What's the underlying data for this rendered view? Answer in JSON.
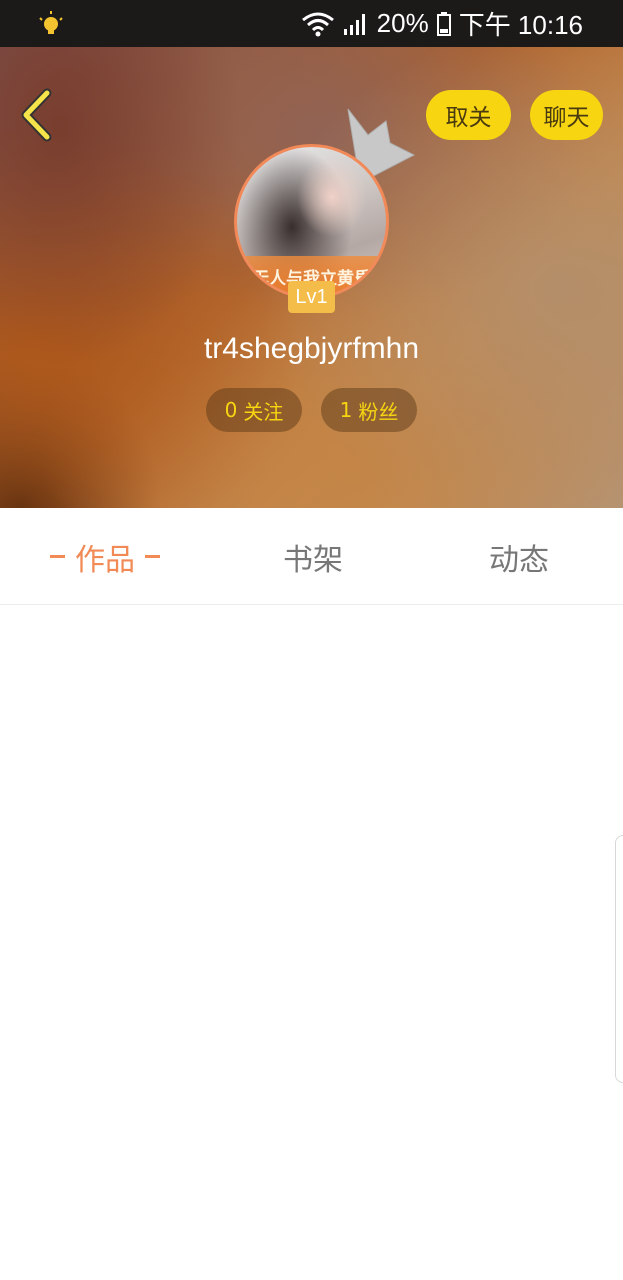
{
  "status_bar": {
    "battery_percent": "20%",
    "time": "下午 10:16",
    "icons": [
      "notification-bulb-icon",
      "wifi-icon",
      "signal-icon",
      "battery-icon"
    ]
  },
  "header": {
    "back_icon": "chevron-left-icon",
    "unfollow_label": "取关",
    "chat_label": "聊天",
    "avatar_caption": "无人与我立黄昏",
    "level": "Lv1",
    "username": "tr4shegbjyrfmhn",
    "following_count": "0",
    "following_label": "关注",
    "fans_count": "1",
    "fans_label": "粉丝"
  },
  "tabs": [
    {
      "label": "作品",
      "active": true
    },
    {
      "label": "书架",
      "active": false
    },
    {
      "label": "动态",
      "active": false
    }
  ],
  "colors": {
    "accent_orange": "#f18a55",
    "button_yellow": "#f7d511",
    "status_bar_bg": "#1c1a19"
  }
}
